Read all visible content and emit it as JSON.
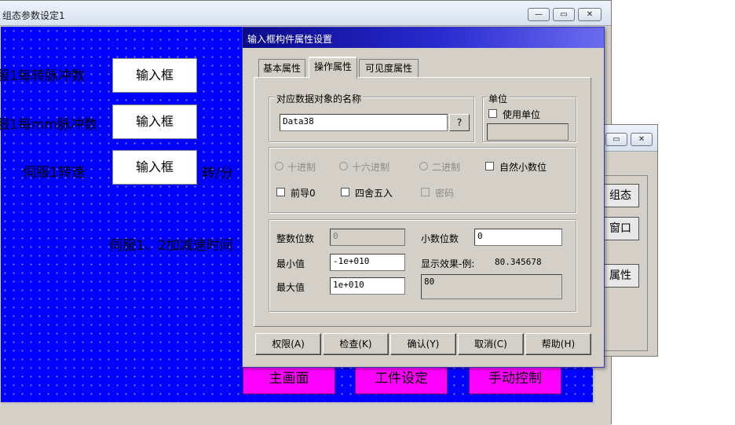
{
  "background_window": {
    "title": "组态参数设定1",
    "controls": {
      "minimize": "—",
      "restore": "▭",
      "close": "✕"
    },
    "canvas": {
      "labels": [
        "服1每转脉冲数",
        "服1每mm脉冲数",
        "伺服1转速",
        "转/分",
        "伺服1、2加减速时间"
      ],
      "inputs": [
        "输入框",
        "输入框",
        "输入框"
      ],
      "bottom_buttons": [
        "主画面",
        "工件设定",
        "手动控制"
      ]
    }
  },
  "second_window": {
    "controls": {
      "restore": "▭",
      "close": "✕"
    },
    "buttons": [
      "组态",
      "窗口",
      "属性"
    ]
  },
  "dialog": {
    "title": "输入框构件属性设置",
    "tabs": [
      "基本属性",
      "操作属性",
      "可见度属性"
    ],
    "active_tab": "操作属性",
    "data_object": {
      "caption": "对应数据对象的名称",
      "value": "Data38",
      "browse_label": "?"
    },
    "unit": {
      "caption": "单位",
      "use_unit_label": "使用单位",
      "value": ""
    },
    "format_options": {
      "decimal": "十进制",
      "hex": "十六进制",
      "binary": "二进制",
      "natural_decimal": "自然小数位",
      "leading_zero": "前导0",
      "rounding": "四舍五入",
      "password": "密码"
    },
    "numbers": {
      "int_digits_label": "整数位数",
      "int_digits_value": "0",
      "dec_digits_label": "小数位数",
      "dec_digits_value": "0",
      "min_label": "最小值",
      "min_value": "-1e+010",
      "max_label": "最大值",
      "max_value": "1e+010",
      "preview_label": "显示效果-例:",
      "preview_example": "80.345678",
      "preview_value": "80"
    },
    "buttons": {
      "permission": "权限(A)",
      "check": "检查(K)",
      "confirm": "确认(Y)",
      "cancel": "取消(C)",
      "help": "帮助(H)"
    }
  }
}
